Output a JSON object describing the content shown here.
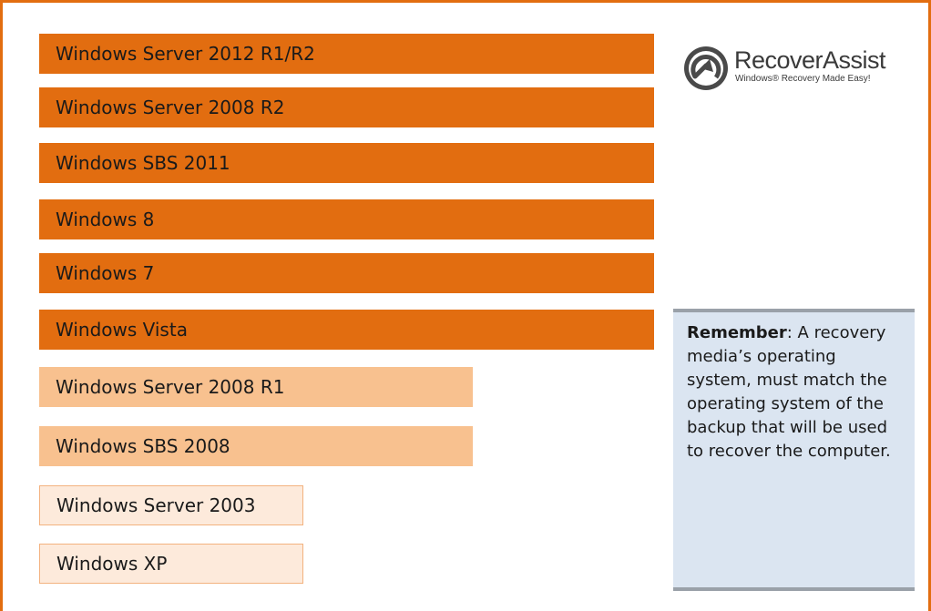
{
  "os_list": [
    {
      "label": "Windows Server 2012 R1/R2",
      "tier": "dark"
    },
    {
      "label": "Windows Server 2008 R2",
      "tier": "dark"
    },
    {
      "label": "Windows SBS 2011",
      "tier": "dark"
    },
    {
      "label": "Windows 8",
      "tier": "dark"
    },
    {
      "label": "Windows 7",
      "tier": "dark"
    },
    {
      "label": "Windows Vista",
      "tier": "dark"
    },
    {
      "label": "Windows Server 2008 R1",
      "tier": "light"
    },
    {
      "label": "Windows SBS 2008",
      "tier": "light"
    },
    {
      "label": "Windows Server 2003",
      "tier": "pale"
    },
    {
      "label": "Windows XP",
      "tier": "pale"
    }
  ],
  "logo": {
    "name": "RecoverAssist",
    "tagline": "Windows® Recovery Made Easy!"
  },
  "note": {
    "emphasis": "Remember",
    "body": ": A recovery media’s operating system, must match the operating system of the backup that will be used to recover the computer."
  },
  "colors": {
    "dark_tier": "#e26d10",
    "light_tier": "#f8c18f",
    "pale_tier": "#fdeadb",
    "note_background": "#dbe5f1"
  }
}
